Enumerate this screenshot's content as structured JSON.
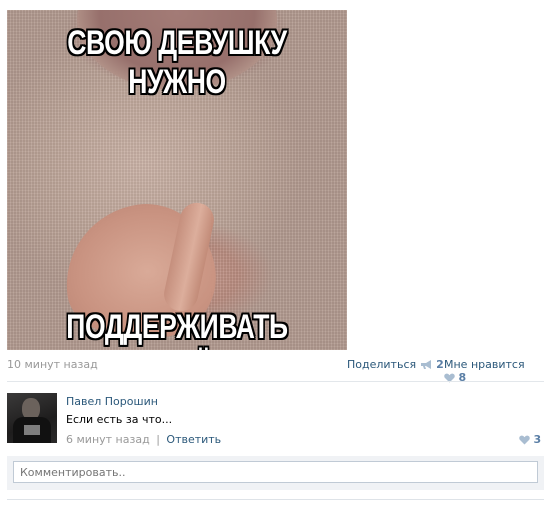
{
  "post": {
    "meme_top_text": "СВОЮ ДЕВУШКУ НУЖНО",
    "meme_bottom_text": "ПОДДЕРЖИВАТЬ ВО ВСЁМ!",
    "time": "10 минут назад",
    "share_label": "Поделиться",
    "share_count": "2",
    "like_label": "Мне нравится",
    "like_count": "8"
  },
  "comment": {
    "author": "Павел Порошин",
    "text": "Если есть за что...",
    "time": "6 минут назад",
    "separator": "|",
    "reply_label": "Ответить",
    "like_count": "3"
  },
  "comment_box": {
    "placeholder": "Комментировать.."
  },
  "colors": {
    "link": "#2b587a",
    "muted": "#999999",
    "count": "#5b7fa6",
    "icon": "#a9bdd1"
  },
  "icons": [
    "megaphone-icon",
    "heart-icon"
  ]
}
